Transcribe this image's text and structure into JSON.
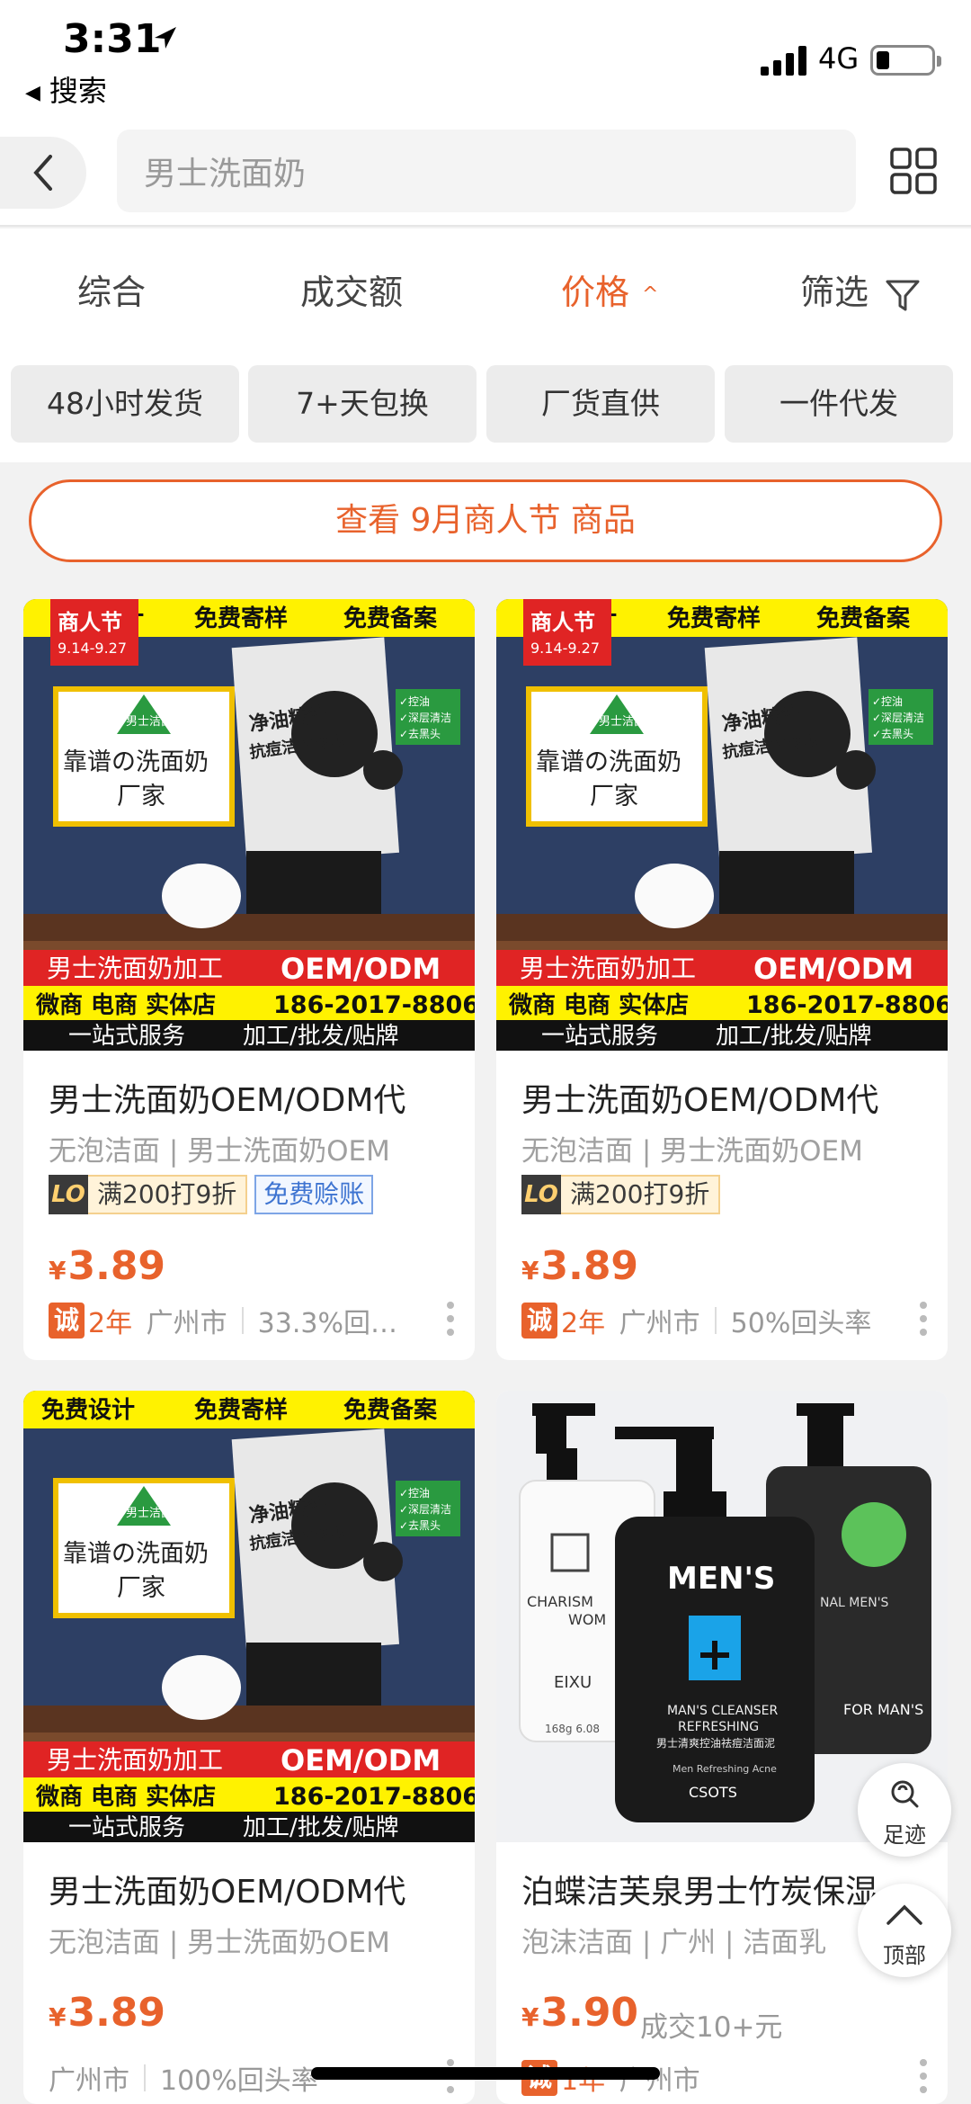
{
  "status_bar": {
    "time": "3:31",
    "back_app": "搜索",
    "network": "4G"
  },
  "search": {
    "query": "男士洗面奶"
  },
  "sort": {
    "items": [
      "综合",
      "成交额",
      "价格",
      "筛选"
    ],
    "active_index": 2
  },
  "chips": [
    "48小时发货",
    "7+天包换",
    "厂货直供",
    "一件代发"
  ],
  "promo": {
    "label": "查看 9月商人节 商品"
  },
  "banner_texts": {
    "top_1": "免费设计",
    "top_2": "免费寄样",
    "top_3": "免费备案",
    "festival": "商人节",
    "festival_dates": "9.14-9.27",
    "box_small": "男士洁面乳",
    "box_main_1": "靠谱の洗面奶",
    "box_main_2": "厂家",
    "tube_text_1": "净油精华",
    "tube_text_2": "抗痘洁面膏泥",
    "feature_1": "✓控油",
    "feature_2": "✓深层清洁",
    "feature_3": "✓去黑头",
    "red_left": "男士洗面奶加工",
    "red_right": "OEM/ODM",
    "yellow_left": "微商 电商 实体店",
    "yellow_right": "186-2017-8806",
    "black_left": "一站式服务",
    "black_right": "加工/批发/贴牌"
  },
  "products": [
    {
      "title": "男士洗面奶OEM/ODM代",
      "subtitle": "无泡洁面 | 男士洗面奶OEM",
      "lo_badge": "LO",
      "discount": "满200打9折",
      "credit": "免费赊账",
      "currency": "¥",
      "price": "3.89",
      "cheng": "诚",
      "years": "2年",
      "location": "广州市",
      "repurchase": "33.3%回…"
    },
    {
      "title": "男士洗面奶OEM/ODM代",
      "subtitle": "无泡洁面 | 男士洗面奶OEM",
      "lo_badge": "LO",
      "discount": "满200打9折",
      "currency": "¥",
      "price": "3.89",
      "cheng": "诚",
      "years": "2年",
      "location": "广州市",
      "repurchase": "50%回头率"
    },
    {
      "title": "男士洗面奶OEM/ODM代",
      "subtitle": "无泡洁面 | 男士洗面奶OEM",
      "currency": "¥",
      "price": "3.89",
      "location": "广州市",
      "repurchase": "100%回头率"
    },
    {
      "title": "泊蝶洁芙泉男士竹炭保湿",
      "subtitle": "泡沫洁面 | 广州 | 洁面乳",
      "currency": "¥",
      "price": "3.90",
      "sold": "成交10+元",
      "cheng": "诚",
      "years": "1年",
      "location": "广州市"
    }
  ],
  "bottle_texts": {
    "mens": "MEN'S",
    "cleanser_1": "MAN'S CLEANSER",
    "cleanser_2": "REFRESHING",
    "cleanser_cn": "男士清爽控油祛痘洁面泥",
    "acne": "Men Refreshing Acne",
    "brand": "CSOTS",
    "left_1": "CHARISM",
    "left_2": "WOM",
    "left_3": "EIXU",
    "left_4": "168g 6.08",
    "right_1": "FOR MAN'S",
    "right_2": "NAL MEN'S"
  },
  "floating": {
    "footprint": "足迹",
    "top": "顶部"
  },
  "colors": {
    "accent": "#e8622c"
  }
}
